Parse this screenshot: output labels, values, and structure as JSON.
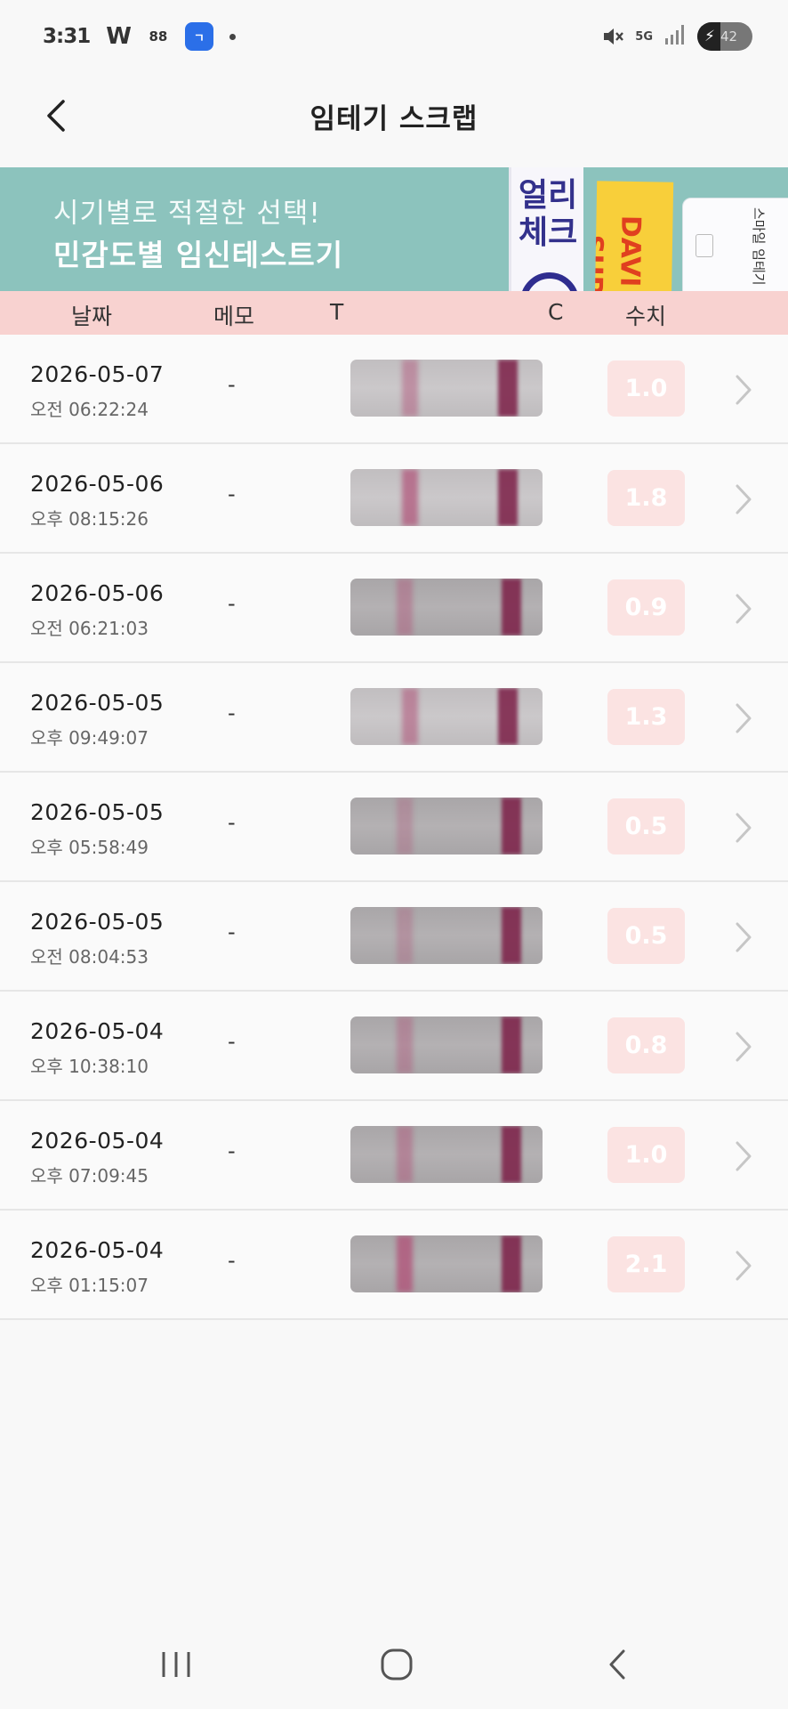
{
  "status_bar": {
    "time": "3:31",
    "app_icon_w": "W",
    "app_icon_88": "88",
    "app_icon_label": "ㄱ",
    "network": "5G",
    "battery_level": "42",
    "battery_fraction": 0.42
  },
  "header": {
    "title": "임테기 스크랩"
  },
  "banner": {
    "line1": "시기별로 적절한 선택!",
    "line2": "민감도별 임신테스트기",
    "product1": "얼리 체크",
    "product2": "-SUPE DAVI",
    "product3": "스마일 임테기"
  },
  "columns": {
    "date": "날짜",
    "memo": "메모",
    "t": "T",
    "c": "C",
    "value": "수치"
  },
  "records": [
    {
      "date": "2026-05-07",
      "time": "오전 06:22:24",
      "memo": "-",
      "value": "1.0",
      "tone": "light"
    },
    {
      "date": "2026-05-06",
      "time": "오후 08:15:26",
      "memo": "-",
      "value": "1.8",
      "tone": "light"
    },
    {
      "date": "2026-05-06",
      "time": "오전 06:21:03",
      "memo": "-",
      "value": "0.9",
      "tone": "dark"
    },
    {
      "date": "2026-05-05",
      "time": "오후 09:49:07",
      "memo": "-",
      "value": "1.3",
      "tone": "light"
    },
    {
      "date": "2026-05-05",
      "time": "오후 05:58:49",
      "memo": "-",
      "value": "0.5",
      "tone": "dark"
    },
    {
      "date": "2026-05-05",
      "time": "오전 08:04:53",
      "memo": "-",
      "value": "0.5",
      "tone": "dark"
    },
    {
      "date": "2026-05-04",
      "time": "오후 10:38:10",
      "memo": "-",
      "value": "0.8",
      "tone": "dark"
    },
    {
      "date": "2026-05-04",
      "time": "오후 07:09:45",
      "memo": "-",
      "value": "1.0",
      "tone": "dark"
    },
    {
      "date": "2026-05-04",
      "time": "오후 01:15:07",
      "memo": "-",
      "value": "2.1",
      "tone": "dark"
    }
  ],
  "colors": {
    "banner_bg": "#8cc3bd",
    "column_header_bg": "#f8d2d0",
    "value_badge_bg": "#fbe3e2",
    "control_line": "#7c1f47",
    "test_line": "#b0557a"
  },
  "nav": {
    "recents": "recents-icon",
    "home": "home-icon",
    "back": "back-icon"
  }
}
